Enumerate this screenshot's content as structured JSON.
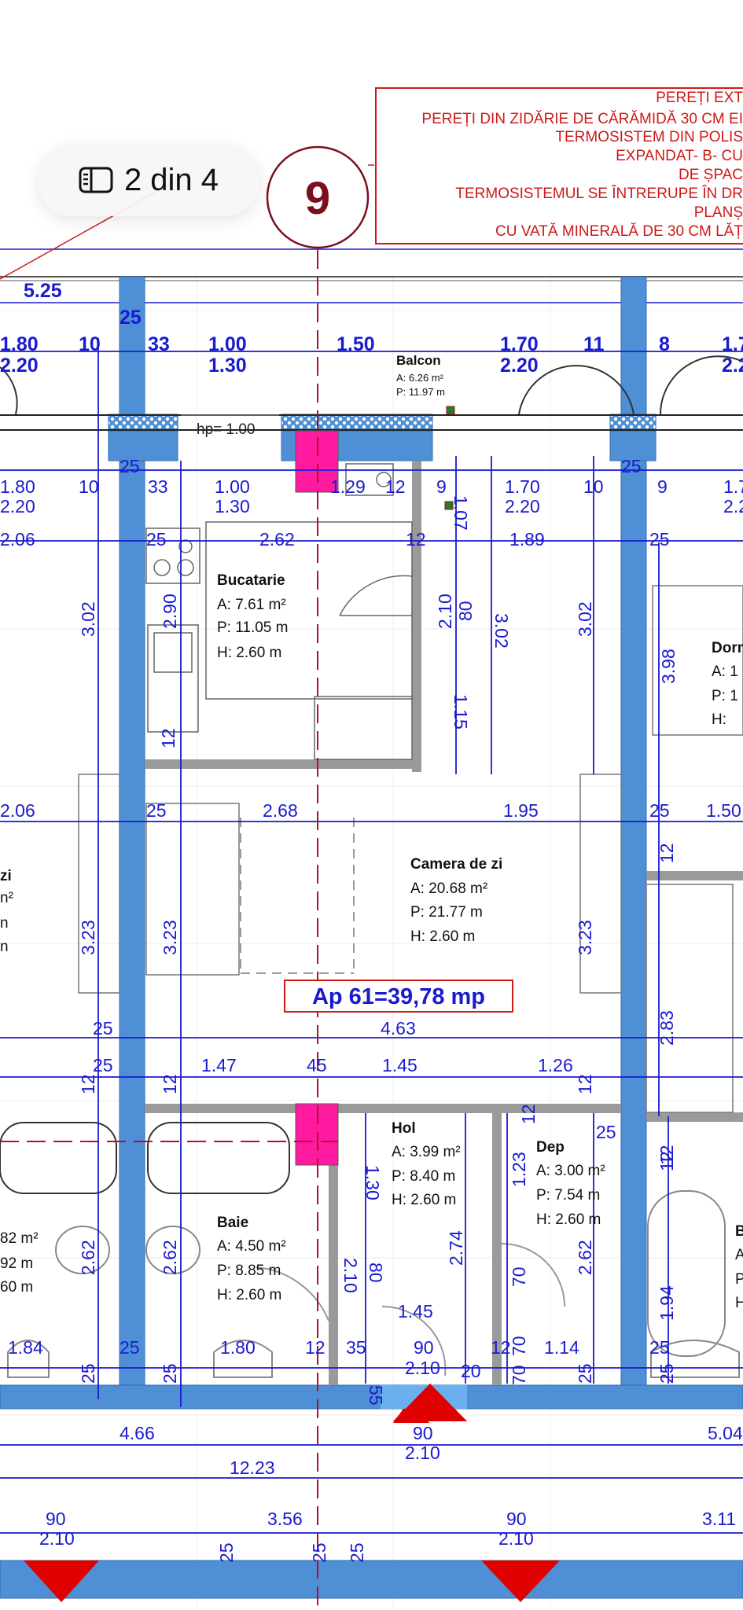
{
  "floor_plan": {
    "apartment_label": "Ap 61=39,78 mp",
    "axis_number": "9",
    "notes": [
      "PEREȚI EXT",
      "PEREȚI DIN ZIDĂRIE DE CĂRĂMIDĂ 30 CM  EI",
      "TERMOSISTEM DIN POLIS",
      "EXPANDAT- B- CU",
      "DE ȘPAC",
      "TERMOSISTEMUL SE ÎNTRERUPE ÎN DR",
      "PLANȘ",
      "CU VATĂ MINERALĂ DE 30 CM LĂȚ"
    ],
    "window_sill_label": "hp= 1.00",
    "rooms": [
      {
        "name": "Balcon",
        "lines": [
          "A:  6.26 m²",
          "P: 11.97 m"
        ]
      },
      {
        "name": "Bucatarie",
        "lines": [
          "A:  7.61 m²",
          "P: 11.05 m",
          "H:  2.60 m"
        ]
      },
      {
        "name": "Camera de zi",
        "lines": [
          "A:     20.68 m²",
          "P:     21.77 m",
          "H:       2.60 m"
        ]
      },
      {
        "name": "Hol",
        "lines": [
          "A: 3.99 m²",
          "P: 8.40 m",
          "H: 2.60 m"
        ]
      },
      {
        "name": "Dep",
        "lines": [
          "A: 3.00 m²",
          "P: 7.54 m",
          "H: 2.60 m"
        ]
      },
      {
        "name": "Baie",
        "lines": [
          "A: 4.50 m²",
          "P: 8.85 m",
          "H: 2.60 m"
        ]
      },
      {
        "name": "Dorm",
        "lines": [
          "A: 1",
          "P: 1",
          "H:"
        ]
      },
      {
        "name": "zi",
        "lines": [
          "n²",
          "n",
          "n"
        ]
      },
      {
        "name": "B",
        "lines": [
          "A",
          "P",
          "H"
        ]
      },
      {
        "name": "",
        "lines": [
          "82 m²",
          "92 m",
          "60 m"
        ]
      }
    ],
    "dimensions": [
      "5.25",
      "25",
      "1.80",
      "2.20",
      "10",
      "33",
      "1.00",
      "1.30",
      "1.50",
      "1.70",
      "2.20",
      "11",
      "8",
      "1.7",
      "2.2",
      "25",
      "1.80",
      "2.20",
      "10",
      "33",
      "1.00",
      "1.30",
      "1.29",
      "12",
      "9",
      "1.70",
      "2.20",
      "10",
      "25",
      "9",
      "1.7",
      "2.2",
      "2.06",
      "25",
      "2.62",
      "12",
      "1.89",
      "25",
      "3.02",
      "2.90",
      "2.10",
      "80",
      "1.07",
      "3.02",
      "3.02",
      "3.98",
      "1.15",
      "12",
      "2.06",
      "25",
      "2.68",
      "1.95",
      "25",
      "1.50",
      "12",
      "3.23",
      "3.23",
      "3.23",
      "25",
      "4.63",
      "25",
      "1.47",
      "45",
      "1.45",
      "1.26",
      "2.83",
      "12",
      "12",
      "12",
      "12",
      "25",
      "12",
      "1.30",
      "1.23",
      "2.62",
      "2.62",
      "2.62",
      "2.74",
      "2.10",
      "80",
      "70",
      "70",
      "1.94",
      "12",
      "1.45",
      "1.84",
      "25",
      "1.80",
      "12",
      "35",
      "90",
      "12",
      "1.14",
      "25",
      "2.10",
      "20",
      "55",
      "70",
      "25",
      "25",
      "25",
      "25",
      "4.66",
      "90",
      "2.10",
      "5.04",
      "12.23",
      "90",
      "2.10",
      "3.56",
      "90",
      "2.10",
      "3.11",
      "25",
      "25",
      "25"
    ]
  },
  "page_indicator": {
    "text": "2 din 4",
    "icon": "sidebar-icon"
  }
}
